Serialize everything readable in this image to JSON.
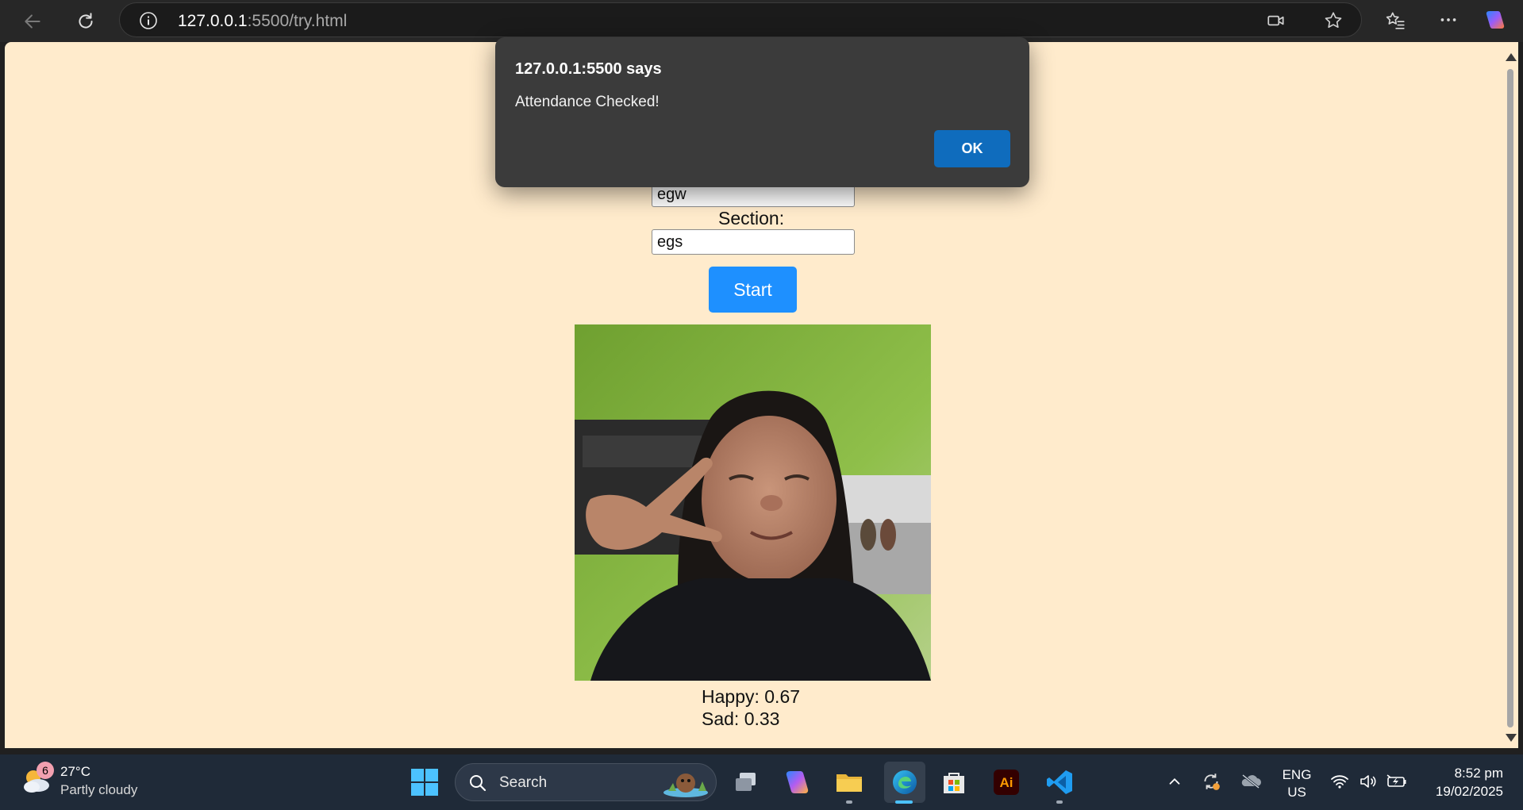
{
  "browser": {
    "url_host": "127.0.0.1",
    "url_rest": ":5500/try.html"
  },
  "page": {
    "name_value": "egw",
    "section_label": "Section:",
    "section_value": "egs",
    "start_label": "Start",
    "emotions": [
      {
        "text": "Happy: 0.67"
      },
      {
        "text": "Sad: 0.33"
      }
    ]
  },
  "dialog": {
    "title": "127.0.0.1:5500 says",
    "message": "Attendance Checked!",
    "ok_label": "OK"
  },
  "taskbar": {
    "weather_badge": "6",
    "weather_temp": "27°C",
    "weather_desc": "Partly cloudy",
    "search_label": "Search",
    "lang_line1": "ENG",
    "lang_line2": "US",
    "time": "8:52 pm",
    "date": "19/02/2025",
    "apps": [
      "start-icon",
      "task-view-icon",
      "copilot-icon",
      "file-explorer-icon",
      "edge-icon",
      "microsoft-store-icon",
      "illustrator-icon",
      "vscode-icon"
    ]
  },
  "colors": {
    "page_background": "#ffebcc",
    "start_button": "#1e90ff",
    "dialog_background": "#3b3b3b",
    "dialog_ok": "#0f6cbd",
    "taskbar": "#1f2a38"
  }
}
